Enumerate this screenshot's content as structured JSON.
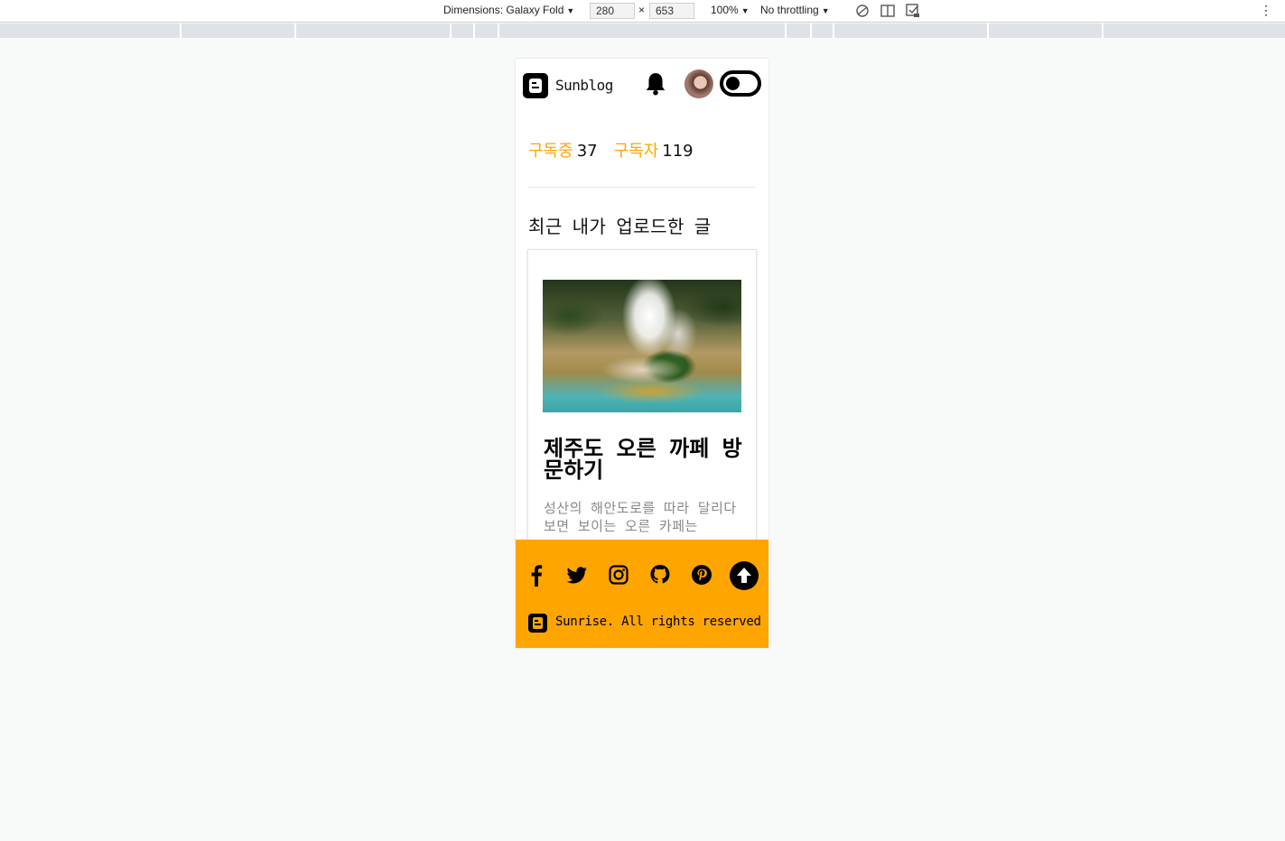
{
  "devtools": {
    "dimensions_label": "Dimensions: Galaxy Fold",
    "width_value": "280",
    "times": "×",
    "height_value": "653",
    "zoom": "100%",
    "throttling": "No throttling",
    "more_icon": "⋮"
  },
  "header": {
    "brand": "Sunblog",
    "logo_icon": "blogger-logo-icon",
    "bell_icon": "bell-icon",
    "avatar_icon": "avatar",
    "toggle_icon": "dark-mode-toggle"
  },
  "stats": {
    "following_label": "구독중",
    "following_count": "37",
    "followers_label": "구독자",
    "followers_count": "119"
  },
  "section_title": "최근 내가 업로드한 글",
  "post": {
    "title": "제주도 오른 까페 방문하기",
    "excerpt": "성산의 해안도로를 따라 달리다 보면 보이는 오른 카페는"
  },
  "footer": {
    "social_icons": [
      "facebook-icon",
      "twitter-icon",
      "instagram-icon",
      "github-icon",
      "pinterest-icon"
    ],
    "up_icon": "arrow-up-icon",
    "copyright": "Sunrise. All rights reserved"
  },
  "colors": {
    "accent": "#ffa500",
    "background": "#f8f9f9",
    "text": "#111111",
    "muted": "#888888"
  }
}
